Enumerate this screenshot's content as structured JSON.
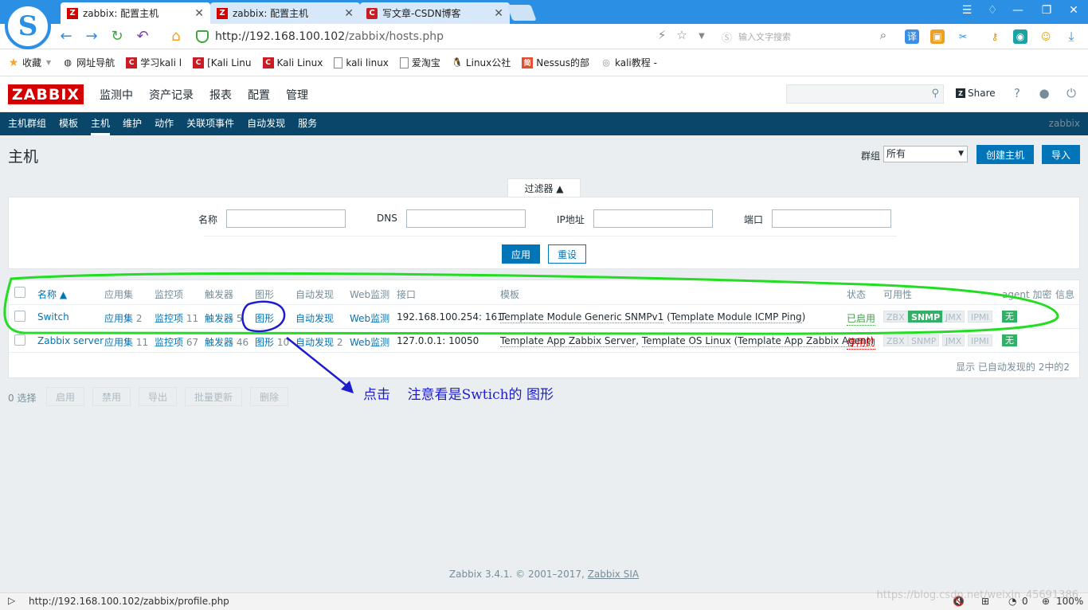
{
  "browser": {
    "tabs": [
      {
        "title": "zabbix: 配置主机",
        "fav": "Z"
      },
      {
        "title": "zabbix: 配置主机",
        "fav": "Z"
      },
      {
        "title": "写文章-CSDN博客",
        "fav": "C"
      }
    ],
    "url_host": "http://192.168.100.102",
    "url_path": "/zabbix/hosts.php",
    "search_placeholder": "输入文字搜索",
    "bookmarks": [
      "收藏",
      "网址导航",
      "学习kali l",
      "[Kali Linu",
      "Kali Linux",
      "kali linux",
      "爱淘宝",
      "Linux公社",
      "Nessus的部",
      "kali教程 -"
    ]
  },
  "zabbix": {
    "logo": "ZABBIX",
    "main_menu": [
      "监测中",
      "资产记录",
      "报表",
      "配置",
      "管理"
    ],
    "share_label": "Share",
    "sub_menu": [
      "主机群组",
      "模板",
      "主机",
      "维护",
      "动作",
      "关联项事件",
      "自动发现",
      "服务"
    ],
    "sub_right": "zabbix",
    "page_title": "主机",
    "group_label": "群组",
    "group_value": "所有",
    "create_host": "创建主机",
    "import": "导入",
    "filter": {
      "toggle": "过滤器 ▲",
      "name_label": "名称",
      "dns_label": "DNS",
      "ip_label": "IP地址",
      "port_label": "端口",
      "apply": "应用",
      "reset": "重设"
    },
    "table": {
      "headers": {
        "name": "名称 ▲",
        "apps": "应用集",
        "items": "监控项",
        "triggers": "触发器",
        "graphs": "图形",
        "discovery": "自动发现",
        "web": "Web监测",
        "interface": "接口",
        "templates": "模板",
        "status": "状态",
        "availability": "可用性",
        "encryption": "agent 加密",
        "info": "信息"
      },
      "rows": [
        {
          "name": "Switch",
          "apps": "应用集",
          "apps_n": "2",
          "items": "监控项",
          "items_n": "11",
          "triggers": "触发器",
          "triggers_n": "5",
          "graphs": "图形",
          "graphs_n": "",
          "discovery": "自动发现",
          "discovery_n": "",
          "web": "Web监测",
          "interface": "192.168.100.254: 161",
          "tpl1": "Template Module Generic SNMPv1",
          "tpl_open": " (",
          "tpl2": "Template Module ICMP Ping",
          "tpl_close": ")",
          "status": "已启用",
          "avail": [
            "ZBX",
            "SNMP",
            "JMX",
            "IPMI"
          ],
          "enc": "无"
        },
        {
          "name": "Zabbix server",
          "apps": "应用集",
          "apps_n": "11",
          "items": "监控项",
          "items_n": "67",
          "triggers": "触发器",
          "triggers_n": "46",
          "graphs": "图形",
          "graphs_n": "10",
          "discovery": "自动发现",
          "discovery_n": "2",
          "web": "Web监测",
          "interface": "127.0.0.1: 10050",
          "tpl1": "Template App Zabbix Server",
          "tpl_sep": ", ",
          "tpl2": "Template OS Linux",
          "tpl_open": " (",
          "tpl3": "Template App Zabbix Agent",
          "tpl_close": ")",
          "status": "停用的",
          "avail": [
            "ZBX",
            "SNMP",
            "JMX",
            "IPMI"
          ],
          "enc": "无"
        }
      ],
      "footer": "显示 已自动发现的 2中的2"
    },
    "selected": "0 选择",
    "mass_buttons": [
      "启用",
      "禁用",
      "导出",
      "批量更新",
      "删除"
    ],
    "footer_text": "Zabbix 3.4.1. © 2001–2017, ",
    "footer_link": "Zabbix SIA"
  },
  "annotation": {
    "text": "点击    注意看是Swtich的 图形"
  },
  "statusbar": {
    "url": "http://192.168.100.102/zabbix/profile.php",
    "count": "0",
    "zoom": "100%"
  },
  "watermark": "https://blog.csdn.net/weixin_45691386",
  "colors": {
    "zabbix_red": "#d40000",
    "nav_blue": "#0a466a",
    "link_blue": "#0275b8",
    "ok_green": "#34af67",
    "annot_green": "#22dd22",
    "annot_blue": "#1c1ccc"
  }
}
